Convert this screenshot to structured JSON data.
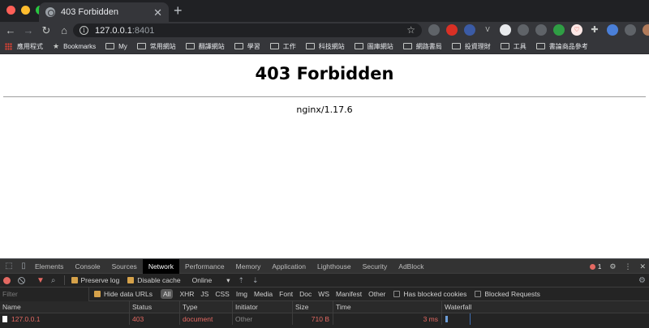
{
  "tab": {
    "title": "403 Forbidden"
  },
  "omnibox": {
    "url_host": "127.0.0.1",
    "url_port": ":8401"
  },
  "bookmarks": [
    {
      "label": "應用程式",
      "icon": "apps-grid-icon"
    },
    {
      "label": "Bookmarks",
      "icon": "star-icon"
    },
    {
      "label": "My",
      "icon": "folder-icon"
    },
    {
      "label": "常用網站",
      "icon": "folder-icon"
    },
    {
      "label": "翻譯網站",
      "icon": "folder-icon"
    },
    {
      "label": "學習",
      "icon": "folder-icon"
    },
    {
      "label": "工作",
      "icon": "folder-icon"
    },
    {
      "label": "科技網站",
      "icon": "folder-icon"
    },
    {
      "label": "圖庫網站",
      "icon": "folder-icon"
    },
    {
      "label": "網路書局",
      "icon": "folder-icon"
    },
    {
      "label": "投資理財",
      "icon": "folder-icon"
    },
    {
      "label": "工具",
      "icon": "folder-icon"
    },
    {
      "label": "書論商品參考",
      "icon": "folder-icon"
    }
  ],
  "page": {
    "heading": "403 Forbidden",
    "server": "nginx/1.17.6"
  },
  "devtools": {
    "tabs": [
      "Elements",
      "Console",
      "Sources",
      "Network",
      "Performance",
      "Memory",
      "Application",
      "Lighthouse",
      "Security",
      "AdBlock"
    ],
    "active_tab": "Network",
    "error_count": "1",
    "toolbar": {
      "preserve_log": "Preserve log",
      "disable_cache": "Disable cache",
      "throttle": "Online"
    },
    "filter": {
      "placeholder": "Filter",
      "hide_data_urls": "Hide data URLs",
      "all": "All",
      "types": [
        "XHR",
        "JS",
        "CSS",
        "Img",
        "Media",
        "Font",
        "Doc",
        "WS",
        "Manifest",
        "Other"
      ],
      "has_blocked_cookies": "Has blocked cookies",
      "blocked_requests": "Blocked Requests"
    },
    "columns": {
      "name": "Name",
      "status": "Status",
      "type": "Type",
      "initiator": "Initiator",
      "size": "Size",
      "time": "Time",
      "waterfall": "Waterfall"
    },
    "rows": [
      {
        "name": "127.0.0.1",
        "status": "403",
        "type": "document",
        "initiator": "Other",
        "size": "710 B",
        "time": "3 ms"
      }
    ]
  }
}
